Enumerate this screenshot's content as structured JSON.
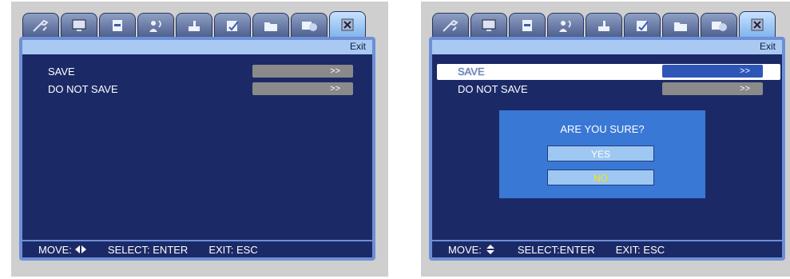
{
  "screens": [
    {
      "exit_label": "Exit",
      "items": [
        {
          "label": "SAVE",
          "action": ">>"
        },
        {
          "label": "DO NOT SAVE",
          "action": ">>"
        }
      ],
      "status": {
        "move": "MOVE:",
        "select": "SELECT: ENTER",
        "exit": "EXIT: ESC"
      }
    },
    {
      "exit_label": "Exit",
      "items": [
        {
          "label": "SAVE",
          "action": ">>"
        },
        {
          "label": "DO NOT SAVE",
          "action": ">>"
        }
      ],
      "dialog": {
        "title": "ARE YOU SURE?",
        "yes": "YES",
        "no": "NO"
      },
      "status": {
        "move": "MOVE:",
        "select": "SELECT:ENTER",
        "exit": "EXIT: ESC"
      }
    }
  ],
  "tab_icons": [
    "tools-icon",
    "monitor-icon",
    "record-icon",
    "network-icon",
    "device-icon",
    "settings-icon",
    "folder-icon",
    "backup-icon",
    "close-icon"
  ]
}
